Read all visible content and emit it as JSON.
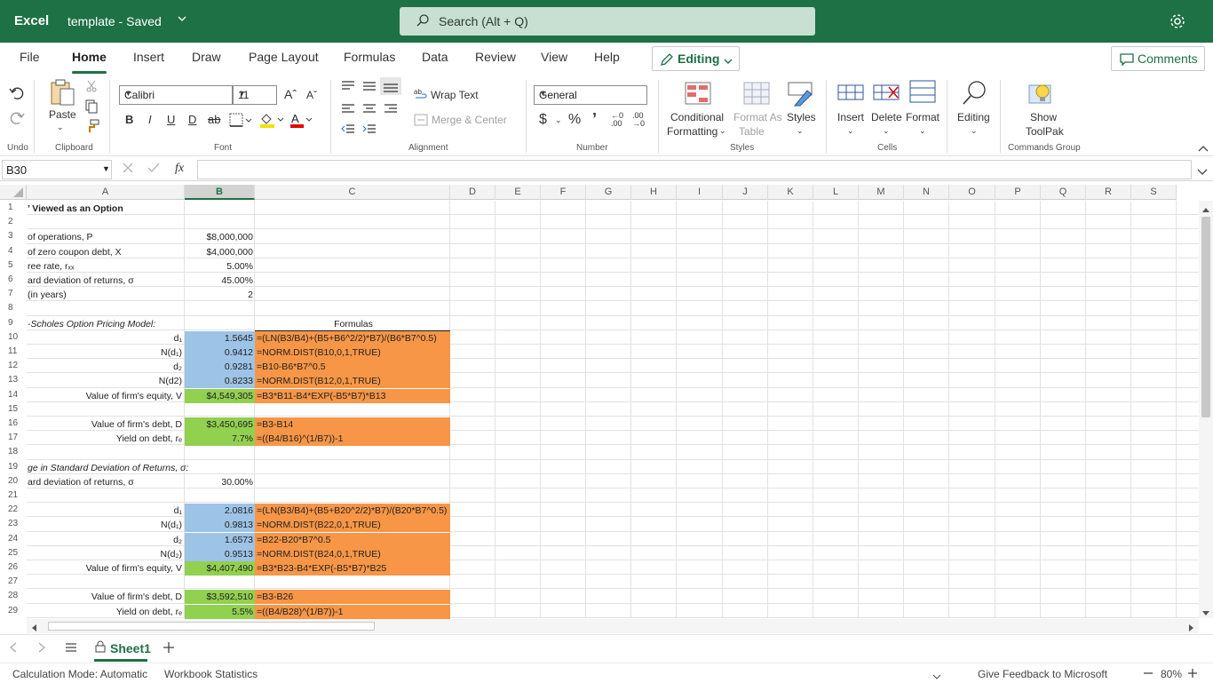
{
  "titlebar": {
    "app_name": "Excel",
    "document": "template  -  Saved",
    "search_placeholder": "Search (Alt + Q)"
  },
  "menu": {
    "tabs": [
      "File",
      "Home",
      "Insert",
      "Draw",
      "Page Layout",
      "Formulas",
      "Data",
      "Review",
      "View",
      "Help"
    ],
    "active_tab": "Home",
    "editing_label": "Editing",
    "comments_label": "Comments"
  },
  "ribbon": {
    "groups": {
      "undo": "Undo",
      "clipboard": "Clipboard",
      "font": "Font",
      "alignment": "Alignment",
      "number": "Number",
      "styles": "Styles",
      "cells": "Cells",
      "commands": "Commands Group"
    },
    "paste_label": "Paste",
    "font_name": "Calibri",
    "font_size": "11",
    "wrap_text": "Wrap Text",
    "merge_center": "Merge & Center",
    "number_format": "General",
    "conditional_formatting": [
      "Conditional",
      "Formatting"
    ],
    "format_as_table": [
      "Format As",
      "Table"
    ],
    "styles_label": "Styles",
    "insert_label": "Insert",
    "delete_label": "Delete",
    "format_label": "Format",
    "editing_label": "Editing",
    "toolpak": [
      "Show",
      "ToolPak"
    ]
  },
  "formula_bar": {
    "name_box": "B30",
    "fx": "fx",
    "content": ""
  },
  "columns": [
    "A",
    "B",
    "C",
    "D",
    "E",
    "F",
    "G",
    "H",
    "I",
    "J",
    "K",
    "L",
    "M",
    "N",
    "O",
    "P",
    "Q",
    "R",
    "S"
  ],
  "selected_column": "B",
  "rows": [
    {
      "n": "1",
      "a": "’ Viewed as an Option",
      "b": "",
      "c": "",
      "a_style": "bold"
    },
    {
      "n": "2",
      "a": "",
      "b": "",
      "c": ""
    },
    {
      "n": "3",
      "a": "of operations, P",
      "b": "$8,000,000",
      "c": ""
    },
    {
      "n": "4",
      "a": "of zero coupon debt, X",
      "b": "$4,000,000",
      "c": ""
    },
    {
      "n": "5",
      "a": "ree rate, rₓₓ",
      "b": "5.00%",
      "c": ""
    },
    {
      "n": "6",
      "a": "ard deviation of returns, σ",
      "b": "45.00%",
      "c": ""
    },
    {
      "n": "7",
      "a": "(in years)",
      "b": "2",
      "c": ""
    },
    {
      "n": "8",
      "a": "",
      "b": "",
      "c": ""
    },
    {
      "n": "9",
      "a": "-Scholes Option Pricing Model:",
      "b": "",
      "c": "Formulas",
      "a_style": "italic"
    },
    {
      "n": "10",
      "a": "d₁",
      "b": "1.5645",
      "c": "=(LN(B3/B4)+(B5+B6^2/2)*B7)/(B6*B7^0.5)",
      "a_style": "right",
      "b_fill": "blue",
      "c_fill": "orange"
    },
    {
      "n": "11",
      "a": "N(d₁)",
      "b": "0.9412",
      "c": "=NORM.DIST(B10,0,1,TRUE)",
      "a_style": "right",
      "b_fill": "blue",
      "c_fill": "orange"
    },
    {
      "n": "12",
      "a": "d₂",
      "b": "0.9281",
      "c": "=B10-B6*B7^0.5",
      "a_style": "right",
      "b_fill": "blue",
      "c_fill": "orange"
    },
    {
      "n": "13",
      "a": "N(d2)",
      "b": "0.8233",
      "c": "=NORM.DIST(B12,0,1,TRUE)",
      "a_style": "right",
      "b_fill": "blue",
      "c_fill": "orange"
    },
    {
      "n": "14",
      "a": "Value of firm's equity, V",
      "b": "$4,549,305",
      "c": "=B3*B11-B4*EXP(-B5*B7)*B13",
      "a_style": "right",
      "b_fill": "green",
      "c_fill": "orange"
    },
    {
      "n": "15",
      "a": "",
      "b": "",
      "c": ""
    },
    {
      "n": "16",
      "a": "Value of firm's debt, D",
      "b": "$3,450,695",
      "c": "=B3-B14",
      "a_style": "right",
      "b_fill": "green",
      "c_fill": "orange"
    },
    {
      "n": "17",
      "a": "Yield on debt, rₑ",
      "b": "7.7%",
      "c": "=((B4/B16)^(1/B7))-1",
      "a_style": "right",
      "b_fill": "green",
      "c_fill": "orange"
    },
    {
      "n": "18",
      "a": "",
      "b": "",
      "c": ""
    },
    {
      "n": "19",
      "a": "ge in Standard Deviation of Returns, σ:",
      "b": "",
      "c": "",
      "a_style": "italic"
    },
    {
      "n": "20",
      "a": "ard deviation of returns, σ",
      "b": "30.00%",
      "c": ""
    },
    {
      "n": "21",
      "a": "",
      "b": "",
      "c": ""
    },
    {
      "n": "22",
      "a": "d₁",
      "b": "2.0816",
      "c": "=(LN(B3/B4)+(B5+B20^2/2)*B7)/(B20*B7^0.5)",
      "a_style": "right",
      "b_fill": "blue",
      "c_fill": "orange"
    },
    {
      "n": "23",
      "a": "N(d₁)",
      "b": "0.9813",
      "c": "=NORM.DIST(B22,0,1,TRUE)",
      "a_style": "right",
      "b_fill": "blue",
      "c_fill": "orange"
    },
    {
      "n": "24",
      "a": "d₂",
      "b": "1.6573",
      "c": "=B22-B20*B7^0.5",
      "a_style": "right",
      "b_fill": "blue",
      "c_fill": "orange"
    },
    {
      "n": "25",
      "a": "N(d₂)",
      "b": "0.9513",
      "c": "=NORM.DIST(B24,0,1,TRUE)",
      "a_style": "right",
      "b_fill": "blue",
      "c_fill": "orange"
    },
    {
      "n": "26",
      "a": "Value of firm's equity, V",
      "b": "$4,407,490",
      "c": "=B3*B23-B4*EXP(-B5*B7)*B25",
      "a_style": "right",
      "b_fill": "green",
      "c_fill": "orange"
    },
    {
      "n": "27",
      "a": "",
      "b": "",
      "c": ""
    },
    {
      "n": "28",
      "a": "Value of firm's debt, D",
      "b": "$3,592,510",
      "c": "=B3-B26",
      "a_style": "right",
      "b_fill": "green",
      "c_fill": "orange"
    },
    {
      "n": "29",
      "a": "Yield on debt, rₑ",
      "b": "5.5%",
      "c": "=((B4/B28)^(1/B7))-1",
      "a_style": "right",
      "b_fill": "green",
      "c_fill": "orange"
    }
  ],
  "sheets": {
    "active": "Sheet1"
  },
  "status": {
    "calc_mode": "Calculation Mode: Automatic",
    "workbook_stats": "Workbook Statistics",
    "feedback": "Give Feedback to Microsoft",
    "zoom": "80%"
  },
  "colors": {
    "brand": "#1e7145",
    "cell_blue": "#9dc3e6",
    "cell_green": "#92d050",
    "cell_orange": "#f79646"
  }
}
